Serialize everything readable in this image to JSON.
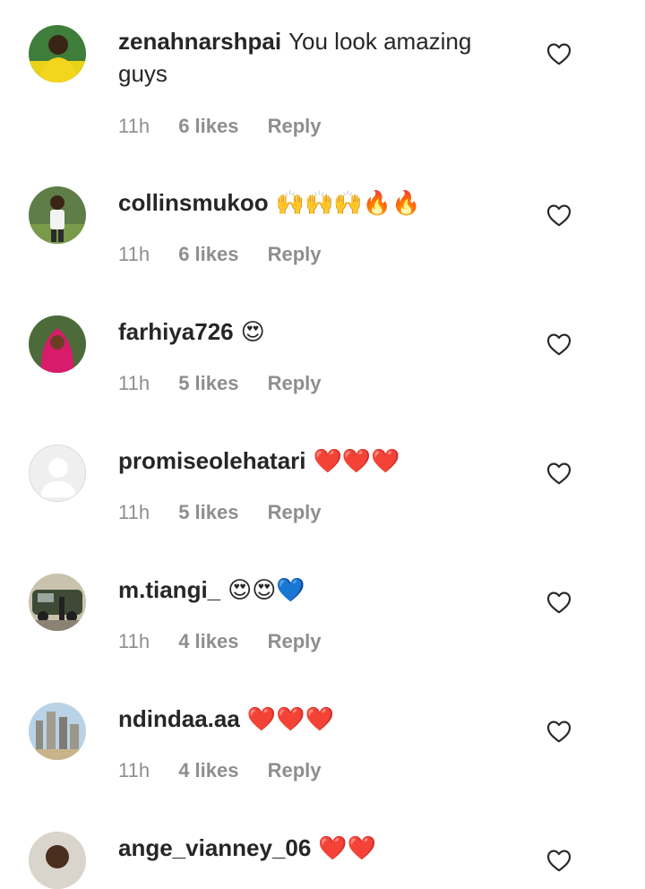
{
  "comments": [
    {
      "username": "zenahnarshpai",
      "text": "You look amazing guys",
      "time": "11h",
      "likes": "6 likes",
      "reply": "Reply",
      "avatar": "avatar-photo-yellow-shirt",
      "heart_icon": "heart-outline-icon"
    },
    {
      "username": "collinsmukoo",
      "text": "🙌🙌🙌🔥🔥",
      "time": "11h",
      "likes": "6 likes",
      "reply": "Reply",
      "avatar": "avatar-photo-white-shirt",
      "heart_icon": "heart-outline-icon"
    },
    {
      "username": "farhiya726",
      "text": "😍",
      "time": "11h",
      "likes": "5 likes",
      "reply": "Reply",
      "avatar": "avatar-photo-pink-hijab",
      "heart_icon": "heart-outline-icon"
    },
    {
      "username": "promiseolehatari",
      "text": "❤️❤️❤️",
      "time": "11h",
      "likes": "5 likes",
      "reply": "Reply",
      "avatar": "avatar-default-gray",
      "heart_icon": "heart-outline-icon"
    },
    {
      "username": "m.tiangi_",
      "text": "😍😍💙",
      "time": "11h",
      "likes": "4 likes",
      "reply": "Reply",
      "avatar": "avatar-photo-car",
      "heart_icon": "heart-outline-icon"
    },
    {
      "username": "ndindaa.aa",
      "text": "❤️❤️❤️",
      "time": "11h",
      "likes": "4 likes",
      "reply": "Reply",
      "avatar": "avatar-photo-city",
      "heart_icon": "heart-outline-icon"
    },
    {
      "username": "ange_vianney_06",
      "text": "❤️❤️",
      "time": "",
      "likes": "",
      "reply": "",
      "avatar": "avatar-photo-person",
      "heart_icon": "heart-outline-icon"
    }
  ]
}
